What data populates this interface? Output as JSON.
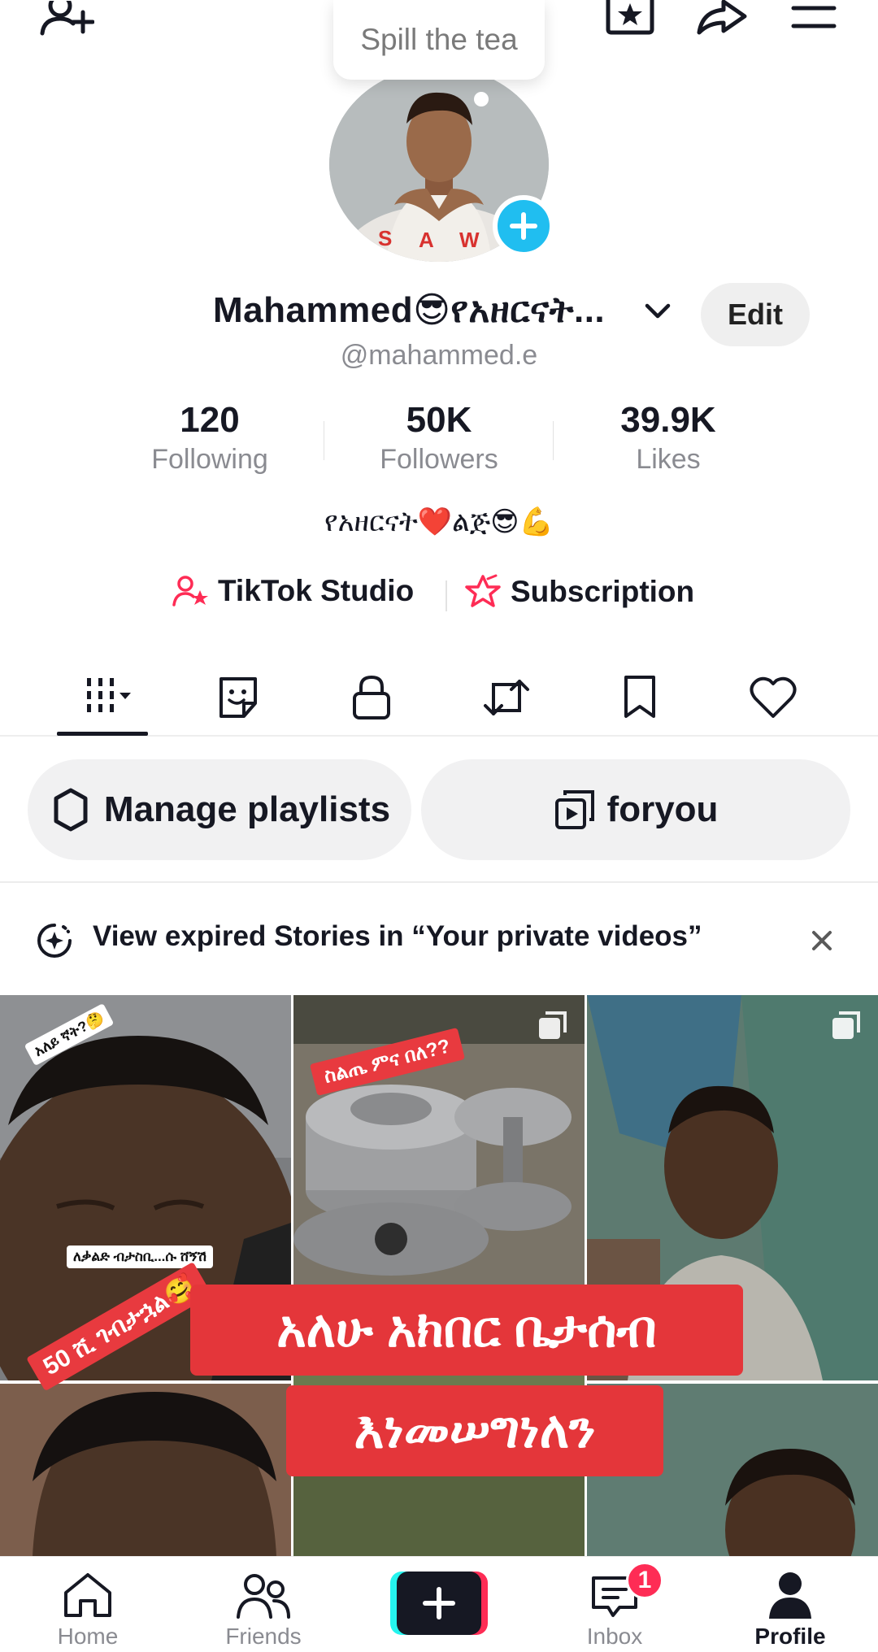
{
  "top_bar": {
    "bubble_text": "Spill the tea",
    "icons": [
      "add-friend-icon",
      "star-calendar-icon",
      "share-icon",
      "menu-icon"
    ]
  },
  "profile": {
    "display_name": "Mahammed😎የአዘርናት...",
    "handle": "@mahammed.e",
    "edit_label": "Edit",
    "bio": "የአዘርናት❤️ልጅ😎💪"
  },
  "stats": [
    {
      "value": "120",
      "label": "Following"
    },
    {
      "value": "50K",
      "label": "Followers"
    },
    {
      "value": "39.9K",
      "label": "Likes"
    }
  ],
  "links": {
    "studio_label": "TikTok Studio",
    "subscription_label": "Subscription"
  },
  "tabs": [
    "videos",
    "favorites",
    "private",
    "reposts",
    "saved",
    "liked"
  ],
  "playlists": {
    "manage_label": "Manage playlists",
    "foryou_label": "foryou"
  },
  "notice": {
    "text": "View expired Stories in “Your private videos”"
  },
  "grid": {
    "tile1_sticker_top": "አለይ ኛት?🤔",
    "tile1_sticker_bottom": "ለቃልድ ብታስቢ...ሱ ሸኝሽ",
    "tile1_red_tag": "50 ሺ ገብታኋል🥰",
    "tile2_red_tag": "ስልጤ ምና በለ??",
    "banner_line1": "አለሁ አክበር ቤታሰብ",
    "banner_line2": "እነመሠግነለን"
  },
  "bottom_nav": {
    "items": [
      {
        "label": "Home"
      },
      {
        "label": "Friends"
      },
      {
        "label": ""
      },
      {
        "label": "Inbox"
      },
      {
        "label": "Profile"
      }
    ],
    "inbox_badge": "1"
  },
  "colors": {
    "accent_pink": "#fe2c55",
    "cyan": "#20bef0",
    "banner_red": "#e4363a"
  }
}
